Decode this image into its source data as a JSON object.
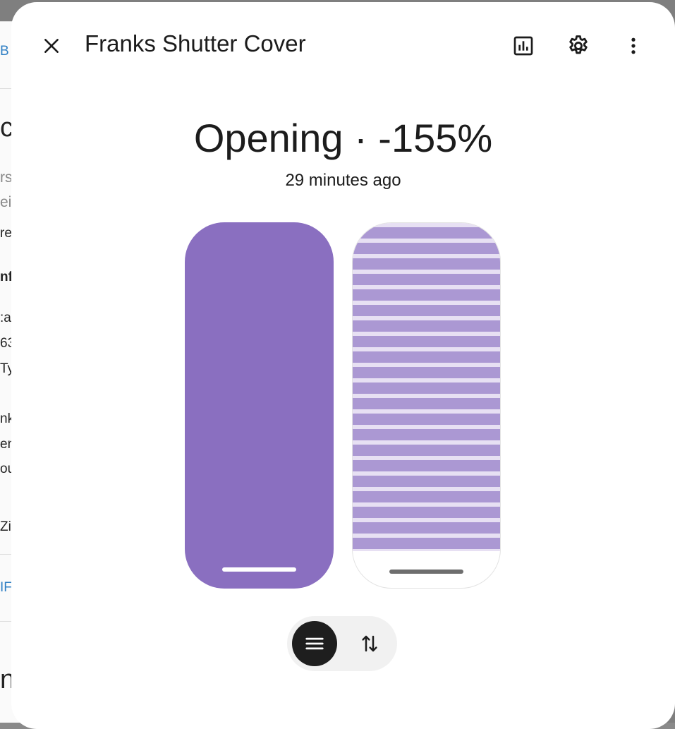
{
  "background_page": {
    "fragments": [
      {
        "text": "B",
        "style": "link"
      },
      {
        "text": "c",
        "style": "big"
      },
      {
        "text": "rs",
        "style": "muted"
      },
      {
        "text": "ei",
        "style": "muted"
      },
      {
        "text": "re",
        "style": "normal"
      },
      {
        "text": "nf",
        "style": "bold"
      },
      {
        "text": ":a",
        "style": "normal"
      },
      {
        "text": "63",
        "style": "normal"
      },
      {
        "text": "Ty",
        "style": "normal"
      },
      {
        "text": "nk",
        "style": "normal"
      },
      {
        "text": "en",
        "style": "normal"
      },
      {
        "text": "ou",
        "style": "normal"
      },
      {
        "text": "Zi",
        "style": "normal"
      },
      {
        "text": "IF",
        "style": "link"
      },
      {
        "text": "n",
        "style": "big"
      }
    ]
  },
  "dialog": {
    "title": "Franks Shutter Cover",
    "header_icons": [
      "close-icon",
      "history-chart-icon",
      "gear-icon",
      "more-vertical-icon"
    ],
    "state": "Opening · -155%",
    "last_changed": "29 minutes ago",
    "position_slider": {
      "level_fraction": 1.0,
      "fill_color": "#8a6fc0",
      "track_color": "#e9e0f5"
    },
    "shutter_visual": {
      "closed_fraction": 0.9,
      "slat_color": "#ab98d3",
      "gap_color": "#e7e0f3"
    },
    "mode_toggle": {
      "buttons": [
        {
          "icon": "menu-lines-icon",
          "active": true
        },
        {
          "icon": "swap-vertical-arrows-icon",
          "active": false
        }
      ]
    }
  }
}
